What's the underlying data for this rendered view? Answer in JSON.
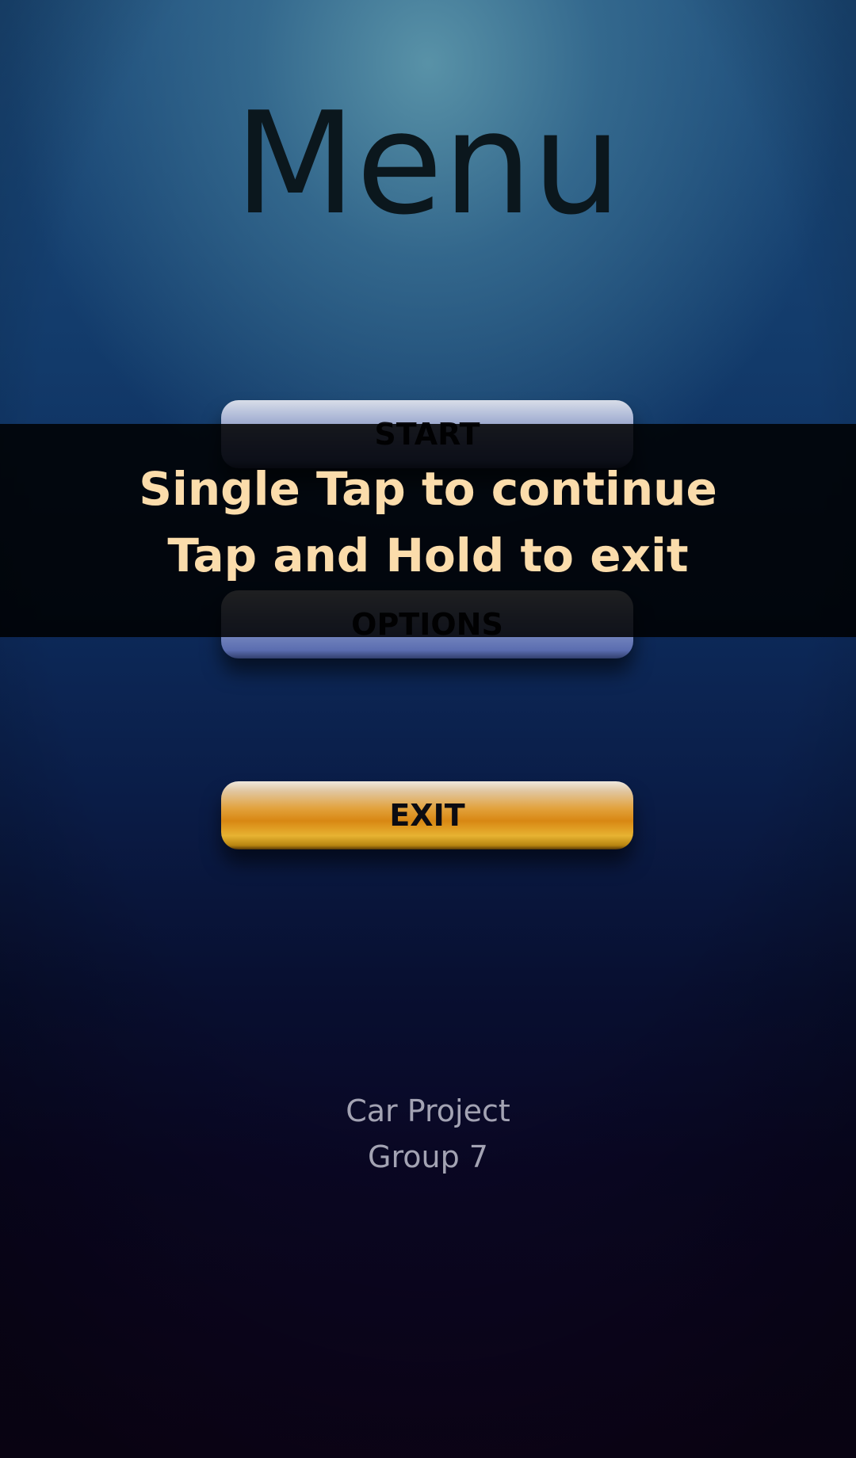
{
  "screen": {
    "title": "Menu"
  },
  "menu": {
    "start_label": "START",
    "options_label": "OPTIONS",
    "exit_label": "EXIT"
  },
  "footer": {
    "line1": "Car Project",
    "line2": "Group 7"
  },
  "toast": {
    "line1": "Single Tap to continue",
    "line2": "Tap and Hold to exit"
  },
  "colors": {
    "toast_text": "#fbdcab",
    "title_text": "#0b171d",
    "footer_text": "#a3a3b3",
    "exit_button": "#d88713",
    "menu_button": "#6f80bb"
  }
}
